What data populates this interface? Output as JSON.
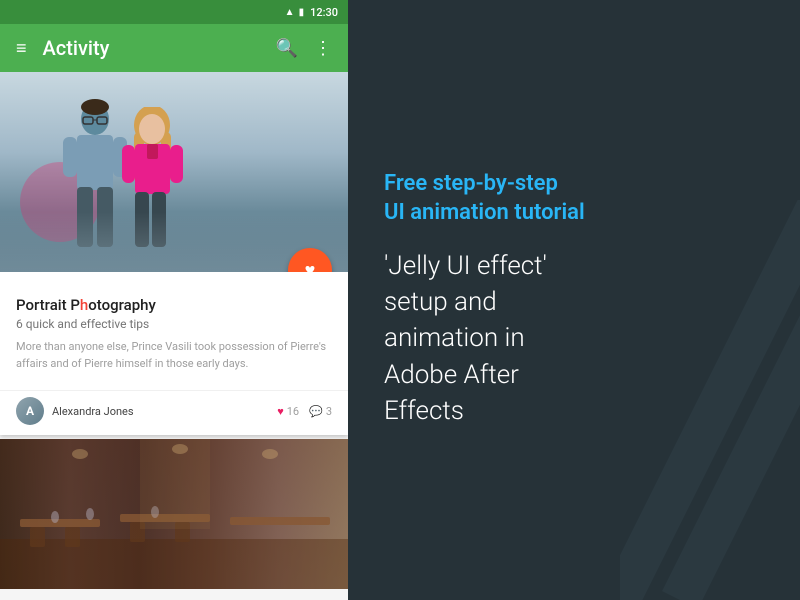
{
  "statusBar": {
    "time": "12:30",
    "signal": "▲",
    "battery": "▮"
  },
  "appBar": {
    "menuIcon": "≡",
    "title": "Activity",
    "searchIcon": "🔍",
    "moreIcon": "⋮"
  },
  "card1": {
    "title_plain": "Portrait P",
    "title_highlight": "h",
    "title_rest": "otography",
    "subtitle": "6 quick and effective tips",
    "text": "More than anyone else, Prince Vasili took possession of Pierre's affairs and of Pierre himself in those early days.",
    "fabIcon": "♥",
    "authorName": "Alexandra Jones",
    "stats": {
      "likes": "16",
      "comments": "3"
    }
  },
  "rightPanel": {
    "subtitle": "Free step-by-step\nUI animation tutorial",
    "mainText": "'Jelly UI effect'\nsetup and\nanimation in\nAdobe After\nEffects"
  }
}
